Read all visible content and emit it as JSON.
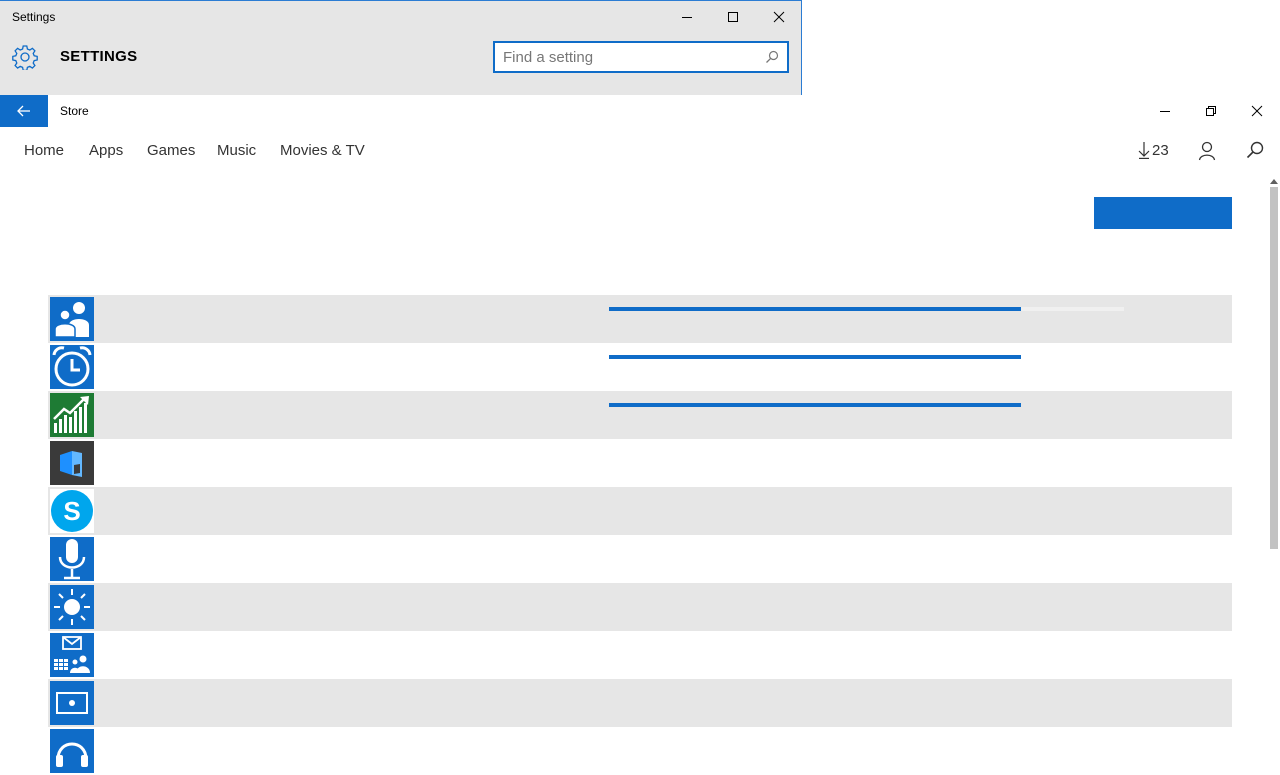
{
  "settings_window": {
    "title": "Settings",
    "heading": "SETTINGS",
    "search": {
      "value": "",
      "placeholder": "Find a setting"
    },
    "icon": "gear-icon"
  },
  "store_window": {
    "title": "Store",
    "nav": {
      "items": [
        {
          "label": "Home"
        },
        {
          "label": "Apps"
        },
        {
          "label": "Games"
        },
        {
          "label": "Music"
        },
        {
          "label": "Movies & TV"
        }
      ]
    },
    "downloads_count": "23",
    "primary_button_label": "",
    "downloads": [
      {
        "icon": "people-icon",
        "color": "#0f6cc8",
        "progress": 0.8
      },
      {
        "icon": "alarm-clock-icon",
        "color": "#0f6cc8",
        "progress": 0.8
      },
      {
        "icon": "money-chart-icon",
        "color": "#1e7b34",
        "progress": 0.8
      },
      {
        "icon": "3d-builder-icon",
        "color": "#3a3a3a",
        "progress": null
      },
      {
        "icon": "skype-icon",
        "color": "#0f6cc8",
        "progress": null
      },
      {
        "icon": "voice-recorder-icon",
        "color": "#0f6cc8",
        "progress": null
      },
      {
        "icon": "weather-icon",
        "color": "#0f6cc8",
        "progress": null
      },
      {
        "icon": "mail-calendar-icon",
        "color": "#0f6cc8",
        "progress": null
      },
      {
        "icon": "movies-tv-icon",
        "color": "#0f6cc8",
        "progress": null
      },
      {
        "icon": "groove-music-icon",
        "color": "#0f6cc8",
        "progress": null
      }
    ]
  },
  "colors": {
    "accent": "#0f6cc8",
    "row_alt": "#e6e6e6",
    "money_green": "#1e7b34",
    "builder_gray": "#3a3a3a"
  }
}
